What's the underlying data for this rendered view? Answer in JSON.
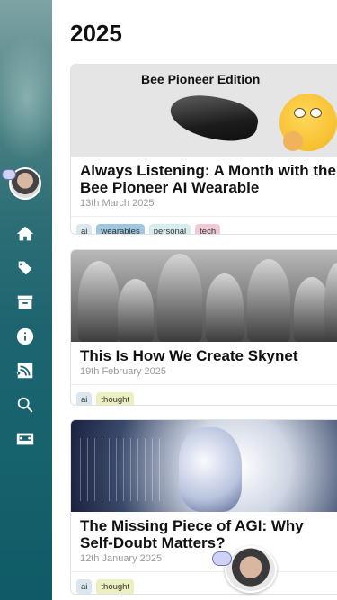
{
  "nav": {
    "items": [
      {
        "icon": "home-icon"
      },
      {
        "icon": "tags-icon"
      },
      {
        "icon": "archive-icon"
      },
      {
        "icon": "info-icon"
      },
      {
        "icon": "rss-icon"
      },
      {
        "icon": "search-icon"
      },
      {
        "icon": "cassette-icon"
      }
    ]
  },
  "page": {
    "year": "2025"
  },
  "posts": [
    {
      "hero_caption": "Bee Pioneer Edition",
      "title": "Always Listening: A Month with the Bee Pioneer AI Wearable",
      "date": "13th March 2025",
      "tags": [
        "ai",
        "wearables",
        "personal",
        "tech"
      ]
    },
    {
      "title": "This Is How We Create Skynet",
      "date": "19th February 2025",
      "tags": [
        "ai",
        "thought"
      ]
    },
    {
      "title": "The Missing Piece of AGI: Why Self-Doubt Matters?",
      "date": "12th January 2025",
      "tags": [
        "ai",
        "thought"
      ]
    }
  ],
  "colors": {
    "sidebar_top": "#7fa3a4",
    "sidebar_bottom": "#0f5a66",
    "tag_ai": "#dbe7ef",
    "tag_wearables": "#9fc7df",
    "tag_personal": "#d7ecee",
    "tag_tech": "#f1c9d6",
    "tag_thought": "#ecefc0"
  }
}
